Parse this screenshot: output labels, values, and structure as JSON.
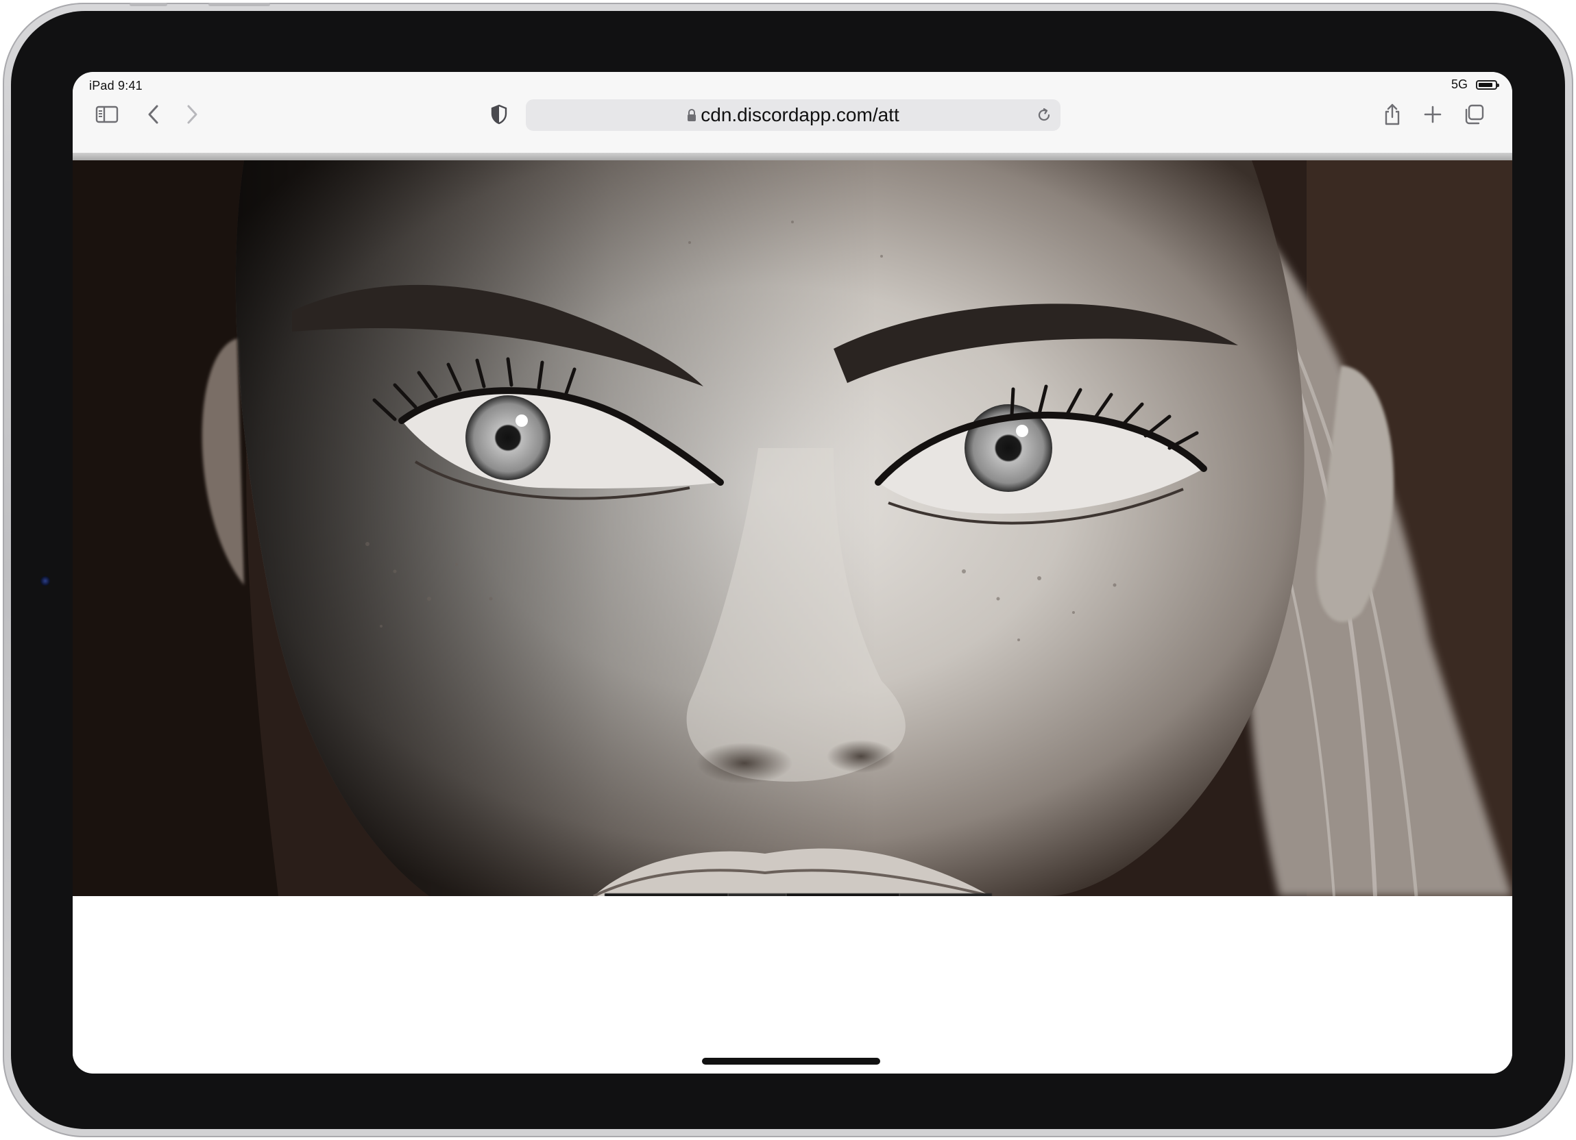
{
  "status_bar": {
    "device_time": "iPad 9:41",
    "network": "5G",
    "battery_level": 0.85
  },
  "toolbar": {
    "url": "cdn.discordapp.com/att",
    "icons": {
      "sidebar": "sidebar-icon",
      "back": "chevron-left-icon",
      "forward": "chevron-right-icon",
      "privacy": "shield-icon",
      "lock": "lock-icon",
      "reload": "reload-icon",
      "share": "share-icon",
      "new_tab": "plus-icon",
      "tabs": "tabs-icon"
    }
  },
  "content": {
    "image_subject": "black-and-white close-up portrait",
    "caption_segments": [
      "",
      "",
      "",
      ""
    ]
  },
  "colors": {
    "toolbar_bg": "#f7f7f7",
    "url_bar_bg": "#e7e7e9",
    "bezel": "#111112"
  }
}
